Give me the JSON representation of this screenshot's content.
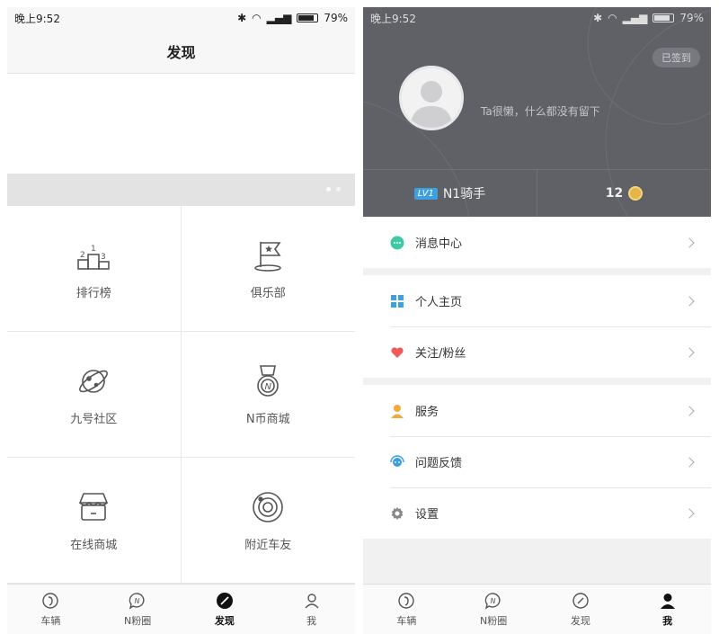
{
  "status": {
    "time": "晚上9:52",
    "battery": "79%"
  },
  "discover": {
    "title": "发现",
    "grid": [
      {
        "label": "排行榜",
        "icon": "podium-icon"
      },
      {
        "label": "俱乐部",
        "icon": "star-flag-icon"
      },
      {
        "label": "九号社区",
        "icon": "planet-icon"
      },
      {
        "label": "N币商城",
        "icon": "medal-icon"
      },
      {
        "label": "在线商城",
        "icon": "store-icon"
      },
      {
        "label": "附近车友",
        "icon": "orbit-icon"
      }
    ]
  },
  "tabs": [
    {
      "label": "车辆",
      "icon": "scooter-wheel-icon"
    },
    {
      "label": "N粉圈",
      "icon": "chat-bubble-n-icon"
    },
    {
      "label": "发现",
      "icon": "compass-icon"
    },
    {
      "label": "我",
      "icon": "person-icon"
    }
  ],
  "me": {
    "signed_label": "已签到",
    "bio": "Ta很懒，什么都没有留下",
    "level_badge": "LV1",
    "rank_name": "N1骑手",
    "coins": "12",
    "groups": [
      [
        {
          "label": "消息中心",
          "icon": "message-icon",
          "color": "#3cc9a4"
        }
      ],
      [
        {
          "label": "个人主页",
          "icon": "grid-icon",
          "color": "#3da0e0"
        },
        {
          "label": "关注/粉丝",
          "icon": "heart-icon",
          "color": "#ef5a5a"
        }
      ],
      [
        {
          "label": "服务",
          "icon": "service-person-icon",
          "color": "#f3a83b"
        },
        {
          "label": "问题反馈",
          "icon": "feedback-icon",
          "color": "#3da0e0"
        },
        {
          "label": "设置",
          "icon": "gear-icon",
          "color": "#888888"
        }
      ]
    ]
  }
}
